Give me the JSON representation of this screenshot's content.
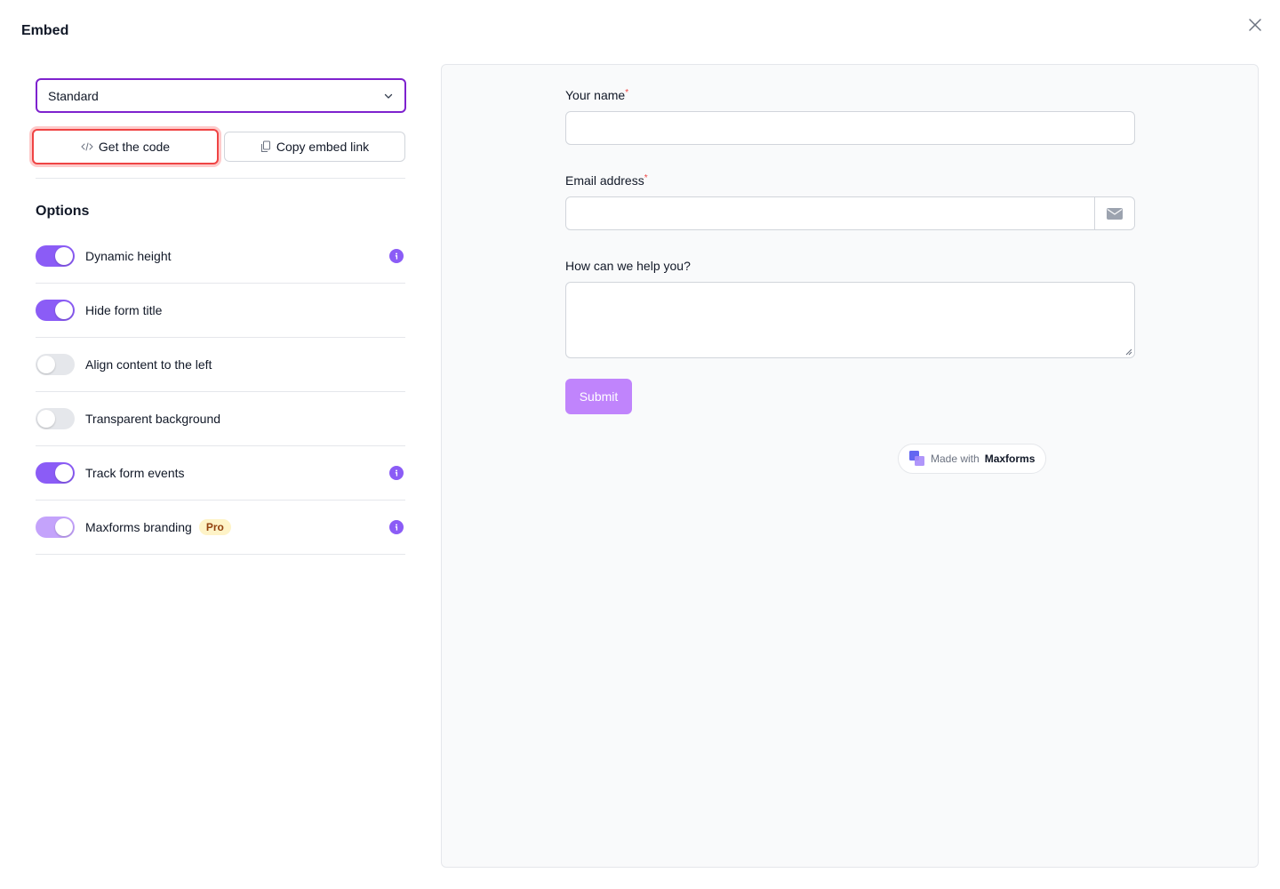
{
  "modal": {
    "title": "Embed"
  },
  "embed": {
    "mode_selected": "Standard",
    "get_code_label": "Get the code",
    "copy_link_label": "Copy embed link"
  },
  "options": {
    "title": "Options",
    "items": [
      {
        "label": "Dynamic height",
        "enabled": true,
        "info": true
      },
      {
        "label": "Hide form title",
        "enabled": true,
        "info": false
      },
      {
        "label": "Align content to the left",
        "enabled": false,
        "info": false
      },
      {
        "label": "Transparent background",
        "enabled": false,
        "info": false
      },
      {
        "label": "Track form events",
        "enabled": true,
        "info": true
      },
      {
        "label": "Maxforms branding",
        "enabled": true,
        "info": true,
        "badge": "Pro"
      }
    ]
  },
  "preview": {
    "fields": {
      "name_label": "Your name",
      "email_label": "Email address",
      "help_label": "How can we help you?",
      "required_mark": "*"
    },
    "submit_label": "Submit",
    "branding": {
      "prefix": "Made with",
      "brand": "Maxforms"
    }
  },
  "colors": {
    "accent": "#8b5cf6",
    "select_border": "#7e22ce",
    "highlight": "#ef4444",
    "submit": "#c084fc"
  }
}
